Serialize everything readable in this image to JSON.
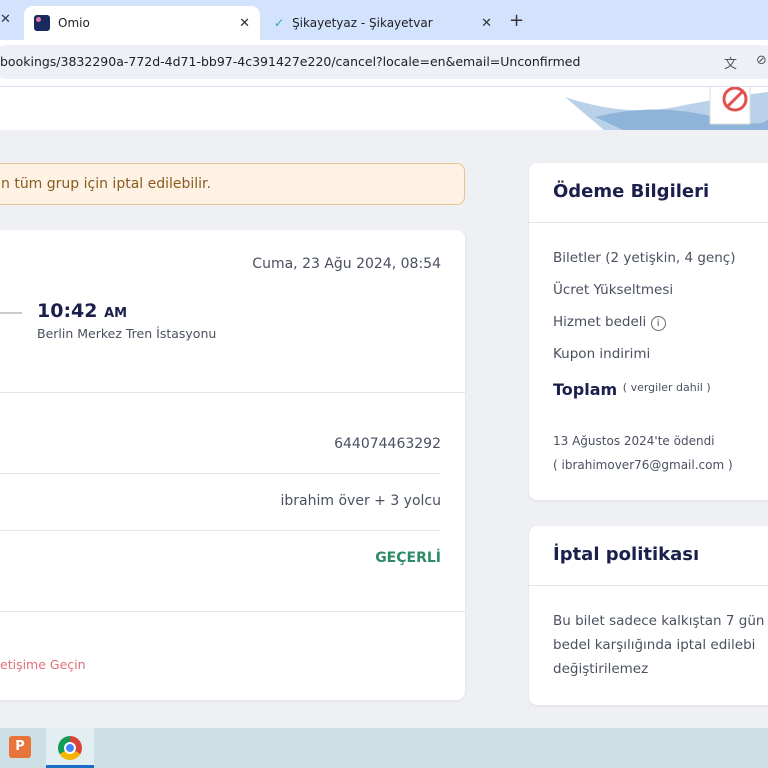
{
  "browser": {
    "tabs": [
      {
        "label": "Omio",
        "active": true
      },
      {
        "label": "Şikayetyaz - Şikayetvar",
        "active": false
      }
    ],
    "url": "bookings/3832290a-772d-4d71-bb97-4c391427e220/cancel?locale=en&email=Unconfirmed"
  },
  "warning": "n tüm grup için iptal edilebilir.",
  "journey": {
    "date": "Cuma, 23 Ağu 2024, 08:54",
    "arrival_time": "10:42",
    "arrival_ampm": "AM",
    "arrival_station": "Berlin Merkez Tren İstasyonu",
    "booking_number": "644074463292",
    "passengers": "ibrahim över + 3 yolcu",
    "status": "GEÇERLİ",
    "status_color": "#2e8b67",
    "contact_link": "etişime Geçin"
  },
  "payment": {
    "title": "Ödeme Bilgileri",
    "tickets": "Biletler  (2 yetişkin, 4 genç)",
    "fare_upgrade": "Ücret Yükseltmesi",
    "service_fee": "Hizmet bedeli",
    "coupon": "Kupon indirimi",
    "total": "Toplam",
    "tax_note": "vergiler dahil",
    "paid_date": "13 Ağustos 2024'te ödendi",
    "email": "( ibrahimover76@gmail.com )"
  },
  "policy": {
    "title": "İptal politikası",
    "lines": [
      "Bu bilet sadece kalkıştan 7 gün",
      "bedel karşılığında iptal edilebi",
      "değiştirilemez"
    ]
  }
}
